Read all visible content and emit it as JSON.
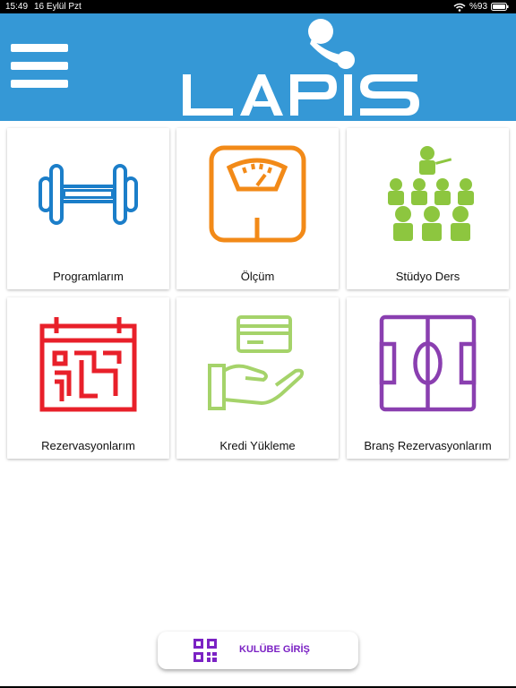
{
  "status_bar": {
    "time": "15:49",
    "date": "16 Eylül Pzt",
    "battery": "%93"
  },
  "header": {
    "logo_text": "LAPIS",
    "background_color": "#3598d6"
  },
  "tiles": [
    {
      "label": "Programlarım",
      "icon": "dumbbell-icon",
      "color": "#1b7ec9"
    },
    {
      "label": "Ölçüm",
      "icon": "scale-icon",
      "color": "#f28a18"
    },
    {
      "label": "Stüdyo Ders",
      "icon": "classroom-icon",
      "color": "#8dc63f"
    },
    {
      "label": "Rezervasyonlarım",
      "icon": "calendar-reservation-icon",
      "color": "#e8202a"
    },
    {
      "label": "Kredi Yükleme",
      "icon": "credit-card-hand-icon",
      "color": "#a5d36a"
    },
    {
      "label": "Branş Rezervasyonlarım",
      "icon": "football-pitch-icon",
      "color": "#8a3fb0"
    }
  ],
  "bottom_button": {
    "label": "KULÜBE GİRİŞ",
    "icon": "qr-code-icon",
    "color": "#7b22c4"
  }
}
